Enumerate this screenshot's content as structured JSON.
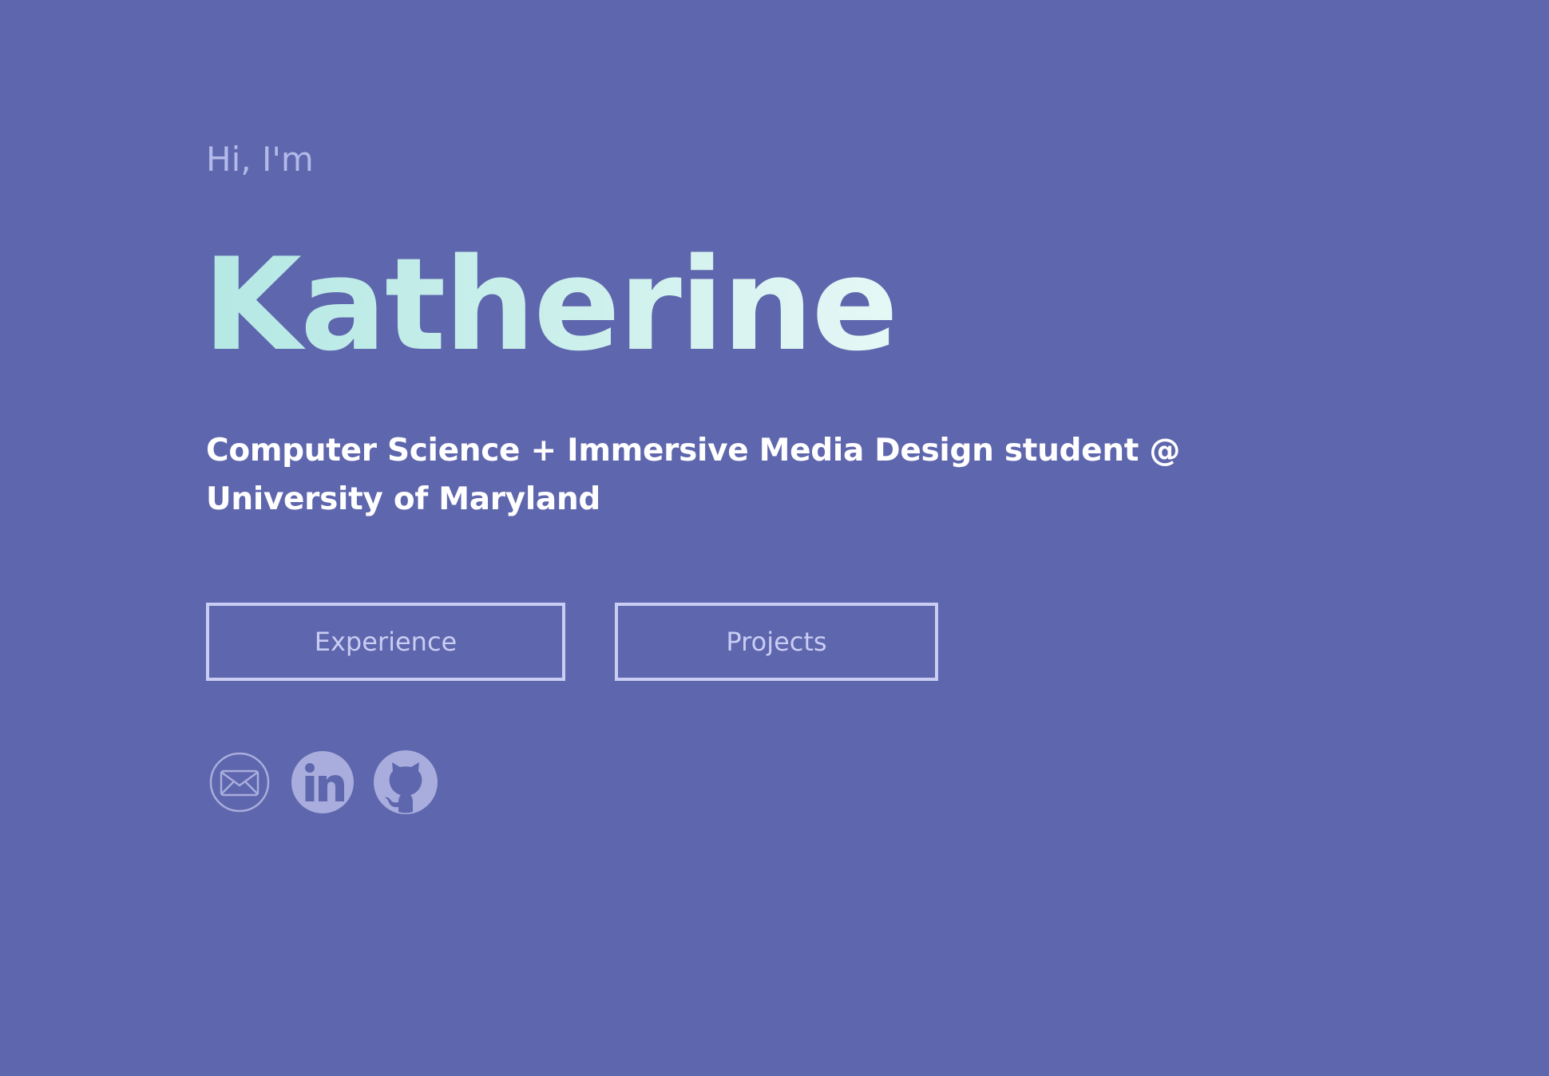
{
  "hero": {
    "greeting": "Hi, I'm",
    "name": "Katherine",
    "tagline": "Computer Science + Immersive Media Design student @ University of Maryland"
  },
  "buttons": {
    "experience": "Experience",
    "projects": "Projects"
  },
  "socials": [
    {
      "icon": "mail-icon"
    },
    {
      "icon": "linkedin-icon"
    },
    {
      "icon": "github-icon"
    }
  ],
  "colors": {
    "background": "#5e66ad",
    "accent": "#c9cdf3",
    "name_gradient_start": "#b5e8e4",
    "name_gradient_end": "#e6f8f6",
    "icon": "#a9addd"
  }
}
